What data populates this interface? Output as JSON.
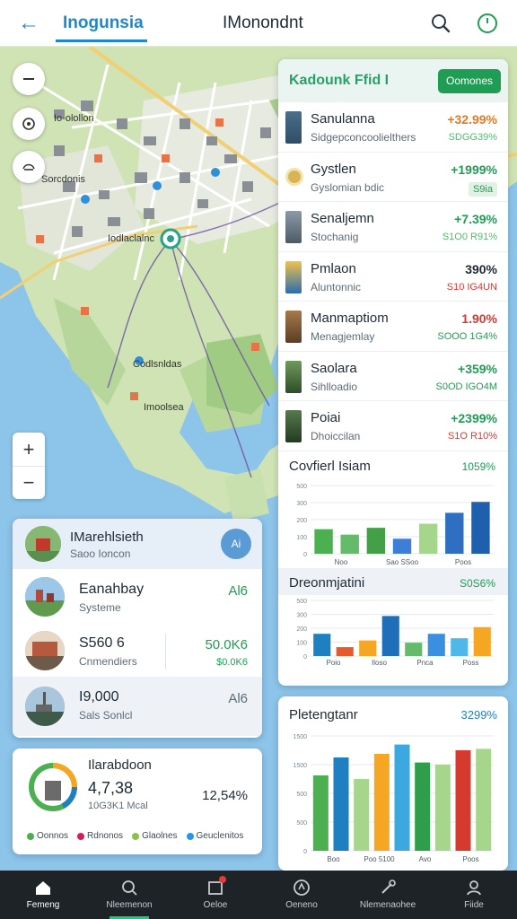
{
  "header": {
    "app_title": "Inogunsia",
    "page_title": "IMonondnt"
  },
  "map": {
    "labels": [
      "Io-olollon",
      "Sorcdonis",
      "Iodlaclalnc",
      "Codlsnldas",
      "Imoolsea"
    ],
    "zoom_in": "+",
    "zoom_out": "−"
  },
  "list": {
    "title": "Kadounk Ffid I",
    "button_label": "Oomones",
    "rows": [
      {
        "name": "Sanulanna",
        "sub": "Sidgepconcoolielthers",
        "pct": "+32.99%",
        "val": "SDGG39%"
      },
      {
        "name": "Gystlen",
        "sub": "Gyslomian bdic",
        "pct": "+1999%",
        "val": "S9ia"
      },
      {
        "name": "Senaljemn",
        "sub": "Stochanig",
        "pct": "+7.39%",
        "val": "S1O0 R91%"
      },
      {
        "name": "Pmlaon",
        "sub": "Aluntonnic",
        "pct": "390%",
        "val": "S10 IG4UN"
      },
      {
        "name": "Manmaptiom",
        "sub": "Menagjemlay",
        "pct": "1.90%",
        "val": "SOOO 1G4%"
      },
      {
        "name": "Saolara",
        "sub": "Sihlloadio",
        "pct": "+359%",
        "val": "S0OD IGO4M"
      },
      {
        "name": "Poiai",
        "sub": "Dhoiccilan",
        "pct": "+2399%",
        "val": "S1O R10%"
      }
    ]
  },
  "sections": {
    "s1_title": "Covfierl Isiam",
    "s1_value": "1059%",
    "s2_title": "Dreonmjatini",
    "s2_value": "S0S6%"
  },
  "chart_data": [
    {
      "type": "bar",
      "title": "Covfierl Isiam",
      "categories": [
        "Noo",
        "Sao SSoo",
        "Poos"
      ],
      "yticks": [
        "500",
        "300",
        "200",
        "100",
        "0"
      ],
      "ylim": [
        0,
        500
      ],
      "values": [
        180,
        140,
        190,
        110,
        220,
        300,
        380
      ],
      "colors": [
        "#4caf50",
        "#66bb6a",
        "#43a047",
        "#3d7fd6",
        "#a5d68c",
        "#2f6fc2",
        "#1e5fae"
      ]
    },
    {
      "type": "bar",
      "title": "Dreonmjatini",
      "categories": [
        "Poio",
        "Iloso",
        "Pnca",
        "Poss"
      ],
      "yticks": [
        "500",
        "300",
        "200",
        "100",
        "0"
      ],
      "ylim": [
        0,
        500
      ],
      "values": [
        200,
        80,
        140,
        360,
        120,
        200,
        160,
        260
      ],
      "colors": [
        "#1e7fc1",
        "#e55b2b",
        "#f5a623",
        "#1e6fb8",
        "#66bb6a",
        "#3b8fe0",
        "#4fb8e8",
        "#f5a623"
      ]
    },
    {
      "type": "bar",
      "title": "Pletengtanr",
      "categories": [
        "Boo",
        "Poo 5100",
        "Avo",
        "Poos"
      ],
      "yticks": [
        "1500",
        "1500",
        "500",
        "500",
        "0"
      ],
      "ylim": [
        0,
        1600
      ],
      "values": [
        1050,
        1300,
        1000,
        1350,
        1480,
        1230,
        1200,
        1400,
        1420
      ],
      "colors": [
        "#4caf50",
        "#1e7fc1",
        "#a5d68c",
        "#f5a623",
        "#3ba9e0",
        "#2e9e4a",
        "#a5d68c",
        "#d63a2f",
        "#a5d68c"
      ]
    }
  ],
  "left_panel": {
    "head_title": "IMarehlsieth",
    "head_sub": "Saoo Ioncon",
    "head_btn": "Ai",
    "rows": [
      {
        "name": "Eanahbay",
        "sub": "Systeme",
        "v1": "Al6",
        "v2": ""
      },
      {
        "name": "S560 6",
        "sub": "Cnmendiers",
        "v1": "50.0K6",
        "v2": "$0.0K6"
      },
      {
        "name": "I9,000",
        "sub": "Sals Sonlcl",
        "v1": "Al6",
        "v2": ""
      }
    ]
  },
  "summary": {
    "title": "Ilarabdoon",
    "number": "4,7,38",
    "sub": "10G3K1 Mcal",
    "pct": "12,54%",
    "legend": [
      {
        "label": "Oonnos",
        "color": "#4caf50"
      },
      {
        "label": "Rdnonos",
        "color": "#d81b60"
      },
      {
        "label": "Glaolnes",
        "color": "#8bc34a"
      },
      {
        "label": "Geuclenitos",
        "color": "#2196f3"
      }
    ]
  },
  "bottom_card": {
    "title": "Pletengtanr",
    "value": "3299%"
  },
  "nav": [
    {
      "label": "Femeng",
      "icon": "home-icon"
    },
    {
      "label": "Nleemenon",
      "icon": "explore-icon"
    },
    {
      "label": "Oeloe",
      "icon": "calendar-icon"
    },
    {
      "label": "Oeneno",
      "icon": "compass-icon"
    },
    {
      "label": "Nlemenaohee",
      "icon": "tools-icon"
    },
    {
      "label": "Fiide",
      "icon": "profile-icon"
    }
  ]
}
